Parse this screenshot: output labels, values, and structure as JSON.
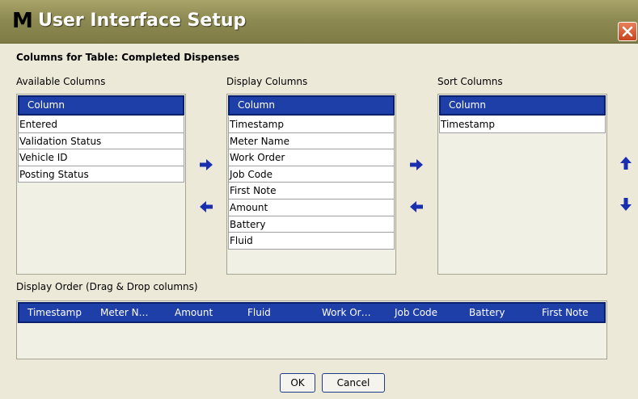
{
  "window": {
    "logo": "M",
    "title": "User Interface Setup"
  },
  "section_title": "Columns for Table: Completed Dispenses",
  "available": {
    "label": "Available Columns",
    "header": "Column",
    "items": [
      "Entered",
      "Validation Status",
      "Vehicle ID",
      "Posting Status"
    ]
  },
  "display": {
    "label": "Display Columns",
    "header": "Column",
    "items": [
      "Timestamp",
      "Meter Name",
      "Work Order",
      "Job Code",
      "First Note",
      "Amount",
      "Battery",
      "Fluid"
    ]
  },
  "sort": {
    "label": "Sort Columns",
    "header": "Column",
    "items": [
      "Timestamp"
    ]
  },
  "display_order": {
    "label": "Display Order (Drag & Drop columns)",
    "columns": [
      "Timestamp",
      "Meter N…",
      "Amount",
      "Fluid",
      "Work Or…",
      "Job Code",
      "Battery",
      "First Note"
    ]
  },
  "buttons": {
    "ok": "OK",
    "cancel": "Cancel"
  },
  "icons": {
    "add_to_display": "arrow-right-icon",
    "remove_from_display": "arrow-left-icon",
    "add_to_sort": "arrow-right-icon",
    "remove_from_sort": "arrow-left-icon",
    "move_up": "arrow-up-icon",
    "move_down": "arrow-down-icon",
    "close": "close-icon"
  },
  "colors": {
    "header_bg": "#1f3fa8",
    "arrow": "#1a2fb0",
    "titlebar": "#8d8a52",
    "close": "#d85a30"
  }
}
